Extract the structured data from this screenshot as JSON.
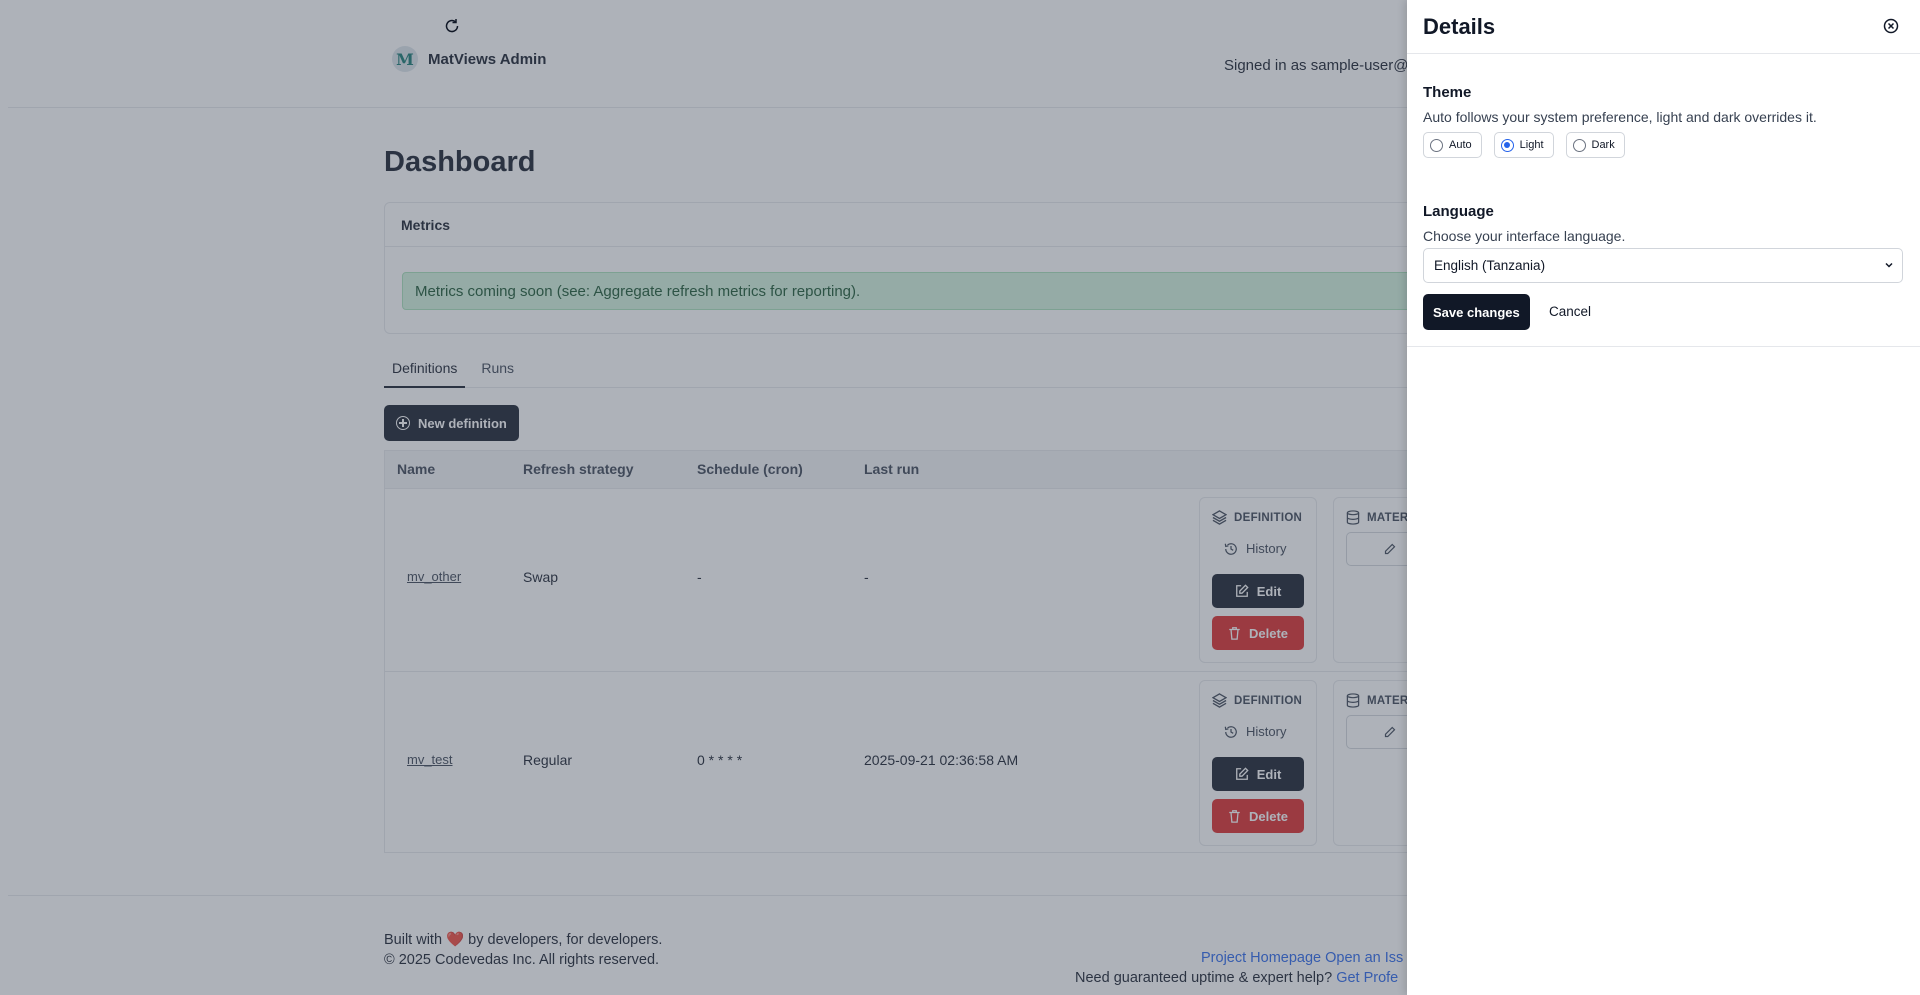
{
  "header": {
    "brand_logo_letter": "M",
    "brand_name": "MatViews Admin",
    "signed_in": "Signed in as sample-user@e"
  },
  "main": {
    "title": "Dashboard",
    "metrics": {
      "title": "Metrics",
      "alert": "Metrics coming soon (see: Aggregate refresh metrics for reporting)."
    },
    "tabs": [
      {
        "label": "Definitions",
        "active": true
      },
      {
        "label": "Runs",
        "active": false
      }
    ],
    "new_definition_label": "New definition",
    "table": {
      "columns": [
        "Name",
        "Refresh strategy",
        "Schedule (cron)",
        "Last run"
      ],
      "rows": [
        {
          "name": "mv_other",
          "strategy": "Swap",
          "schedule": "-",
          "last_run": "-"
        },
        {
          "name": "mv_test",
          "strategy": "Regular",
          "schedule": "0 * * * *",
          "last_run": "2025-09-21 02:36:58 AM"
        }
      ],
      "definition_title": "DEFINITION",
      "materialized_title": "MATER",
      "history_label": "History",
      "edit_label": "Edit",
      "delete_label": "Delete"
    }
  },
  "footer": {
    "built_prefix": "Built with",
    "built_suffix": "by developers, for developers.",
    "copyright": "© 2025 Codevedas Inc. All rights reserved.",
    "links": "Project Homepage Open an Iss",
    "help_text": "Need guaranteed uptime & expert help?",
    "help_link": "Get Profe"
  },
  "drawer": {
    "title": "Details",
    "theme": {
      "title": "Theme",
      "description": "Auto follows your system preference, light and dark overrides it.",
      "options": [
        {
          "label": "Auto",
          "selected": false
        },
        {
          "label": "Light",
          "selected": true
        },
        {
          "label": "Dark",
          "selected": false
        }
      ]
    },
    "language": {
      "title": "Language",
      "description": "Choose your interface language.",
      "selected": "English (Tanzania)"
    },
    "save_label": "Save changes",
    "cancel_label": "Cancel"
  },
  "colors": {
    "primary": "#111827",
    "danger": "#dc2626",
    "accent": "#2563eb",
    "alert_bg": "#d1f2dc"
  },
  "icons": [
    "plus-circle-icon",
    "layers-icon",
    "history-icon",
    "edit-icon",
    "trash-icon",
    "database-icon",
    "pencil-icon",
    "refresh-icon",
    "close-circle-icon",
    "chevron-down-icon",
    "heart-icon"
  ]
}
